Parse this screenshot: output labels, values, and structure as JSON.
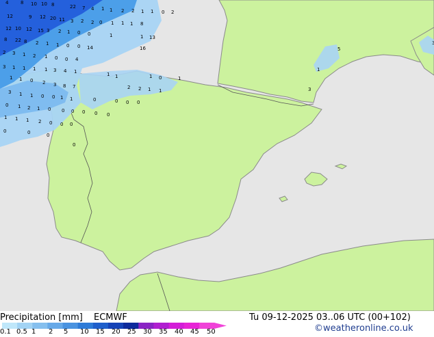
{
  "footer": {
    "title": "Precipitation [mm]",
    "model": "ECMWF",
    "datetime": "Tu 09-12-2025 03..06 UTC (00+102)",
    "credit": "©weatheronline.co.uk"
  },
  "colors": {
    "sea": "#e6e6e6",
    "land": "#ccf29e",
    "coast": "#8a8a8a",
    "border": "#555555",
    "light_blue": "#a8d4f4",
    "mid_blue": "#4c9fe9",
    "dark_blue": "#2460dc"
  },
  "legend": {
    "ticks": [
      "0.1",
      "0.5",
      "1",
      "2",
      "5",
      "10",
      "15",
      "20",
      "25",
      "30",
      "35",
      "40",
      "45",
      "50"
    ],
    "colors": [
      "#bfe7fa",
      "#a2d3f4",
      "#85bfee",
      "#67a9e8",
      "#4a93e0",
      "#2e7bd7",
      "#1f5fcb",
      "#1643b6",
      "#0e2a9c",
      "#8a24c4",
      "#b01fd0",
      "#d31ed8",
      "#e725d6",
      "#f043d8"
    ]
  },
  "precip_labels": [
    "4",
    "8",
    "10",
    "10",
    "8",
    "22",
    "7",
    "4",
    "1",
    "1",
    "2",
    "2",
    "1",
    "1",
    "0",
    "2",
    "12",
    "9",
    "12",
    "20",
    "11",
    "3",
    "2",
    "2",
    "0",
    "1",
    "1",
    "1",
    "8",
    "12",
    "10",
    "12",
    "15",
    "3",
    "2",
    "1",
    "0",
    "0",
    "1",
    "1",
    "13",
    "8",
    "22",
    "8",
    "2",
    "1",
    "1",
    "0",
    "0",
    "14",
    "16",
    "2",
    "3",
    "1",
    "2",
    "1",
    "0",
    "0",
    "4",
    "3",
    "1",
    "1",
    "1",
    "1",
    "3",
    "4",
    "1",
    "1",
    "1",
    "0",
    "2",
    "3",
    "8",
    "7",
    "1",
    "1",
    "1",
    "0",
    "1",
    "1",
    "5",
    "3",
    "3",
    "1",
    "1",
    "0",
    "0",
    "1",
    "1",
    "2",
    "2",
    "1",
    "1",
    "3",
    "0",
    "1",
    "2",
    "1",
    "0",
    "0",
    "0",
    "0",
    "0",
    "0",
    "0",
    "1",
    "1",
    "1",
    "2",
    "0",
    "0",
    "0",
    "0",
    "0",
    "0",
    "0",
    "0",
    "0",
    "0"
  ]
}
